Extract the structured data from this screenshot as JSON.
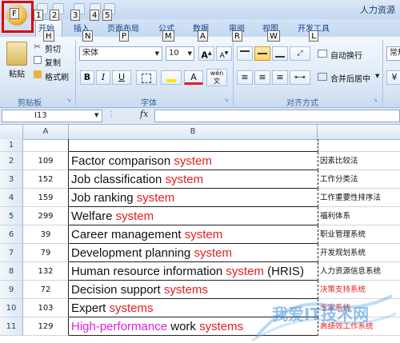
{
  "window": {
    "title": "人力资源"
  },
  "keytips": {
    "office": "F",
    "qat": [
      "1",
      "2",
      "3",
      "4",
      "5"
    ],
    "tabs": [
      "H",
      "N",
      "P",
      "M",
      "A",
      "R",
      "W",
      "L"
    ]
  },
  "tabs": [
    "开始",
    "插入",
    "页面布局",
    "公式",
    "数据",
    "审阅",
    "视图",
    "开发工具"
  ],
  "ribbon": {
    "clipboard": {
      "paste": "粘贴",
      "cut": "剪切",
      "copy": "复制",
      "format_painter": "格式刷",
      "label": "剪贴板"
    },
    "font": {
      "name": "宋体",
      "size": "10",
      "grow": "A",
      "shrink": "A",
      "bold": "B",
      "italic": "I",
      "underline": "U",
      "font_color": "A",
      "wen": "wén",
      "label": "字体"
    },
    "alignment": {
      "wrap": "自动换行",
      "merge": "合并后居中",
      "label": "对齐方式"
    },
    "number": {
      "format": "常规"
    }
  },
  "formula_bar": {
    "cell_ref": "I13",
    "fx": "fx",
    "value": ""
  },
  "columns": [
    "A",
    "B"
  ],
  "rows": [
    {
      "num": "1",
      "a": "",
      "b": [],
      "c": "",
      "c_red": false
    },
    {
      "num": "2",
      "a": "109",
      "b": [
        {
          "t": "Factor comparison ",
          "c": ""
        },
        {
          "t": "system",
          "c": "red"
        }
      ],
      "c": "因素比较法",
      "c_red": false
    },
    {
      "num": "3",
      "a": "152",
      "b": [
        {
          "t": "Job classification ",
          "c": ""
        },
        {
          "t": "system",
          "c": "red"
        }
      ],
      "c": "工作分类法",
      "c_red": false
    },
    {
      "num": "4",
      "a": "159",
      "b": [
        {
          "t": "Job ranking ",
          "c": ""
        },
        {
          "t": "system",
          "c": "red"
        }
      ],
      "c": "工作重要性排序法",
      "c_red": false
    },
    {
      "num": "5",
      "a": "299",
      "b": [
        {
          "t": "Welfare ",
          "c": ""
        },
        {
          "t": "system",
          "c": "red"
        }
      ],
      "c": "福利体系",
      "c_red": false
    },
    {
      "num": "6",
      "a": "39",
      "b": [
        {
          "t": "Career management ",
          "c": ""
        },
        {
          "t": "system",
          "c": "red"
        }
      ],
      "c": "职业管理系统",
      "c_red": false
    },
    {
      "num": "7",
      "a": "79",
      "b": [
        {
          "t": "Development planning ",
          "c": ""
        },
        {
          "t": "system",
          "c": "red"
        }
      ],
      "c": "开发规划系统",
      "c_red": false
    },
    {
      "num": "8",
      "a": "132",
      "b": [
        {
          "t": "Human resource information ",
          "c": ""
        },
        {
          "t": "system",
          "c": "red"
        },
        {
          "t": " (HRIS)",
          "c": ""
        }
      ],
      "c": "人力资源信息系统",
      "c_red": false
    },
    {
      "num": "9",
      "a": "72",
      "b": [
        {
          "t": "Decision support ",
          "c": ""
        },
        {
          "t": "systems",
          "c": "red"
        }
      ],
      "c": "决策支持系统",
      "c_red": true
    },
    {
      "num": "10",
      "a": "103",
      "b": [
        {
          "t": "Expert ",
          "c": ""
        },
        {
          "t": "systems",
          "c": "red"
        }
      ],
      "c": "专家系统",
      "c_red": true
    },
    {
      "num": "11",
      "a": "129",
      "b": [
        {
          "t": "High-performance",
          "c": "pink"
        },
        {
          "t": " work ",
          "c": ""
        },
        {
          "t": "systems",
          "c": "red"
        }
      ],
      "c": "高绩效工作系统",
      "c_red": true
    }
  ],
  "watermark": {
    "text": "我爱IT技术网"
  },
  "colors": {
    "accent_red": "#e0201e",
    "pink": "#e020d8",
    "highlight_border": "#e00000"
  }
}
